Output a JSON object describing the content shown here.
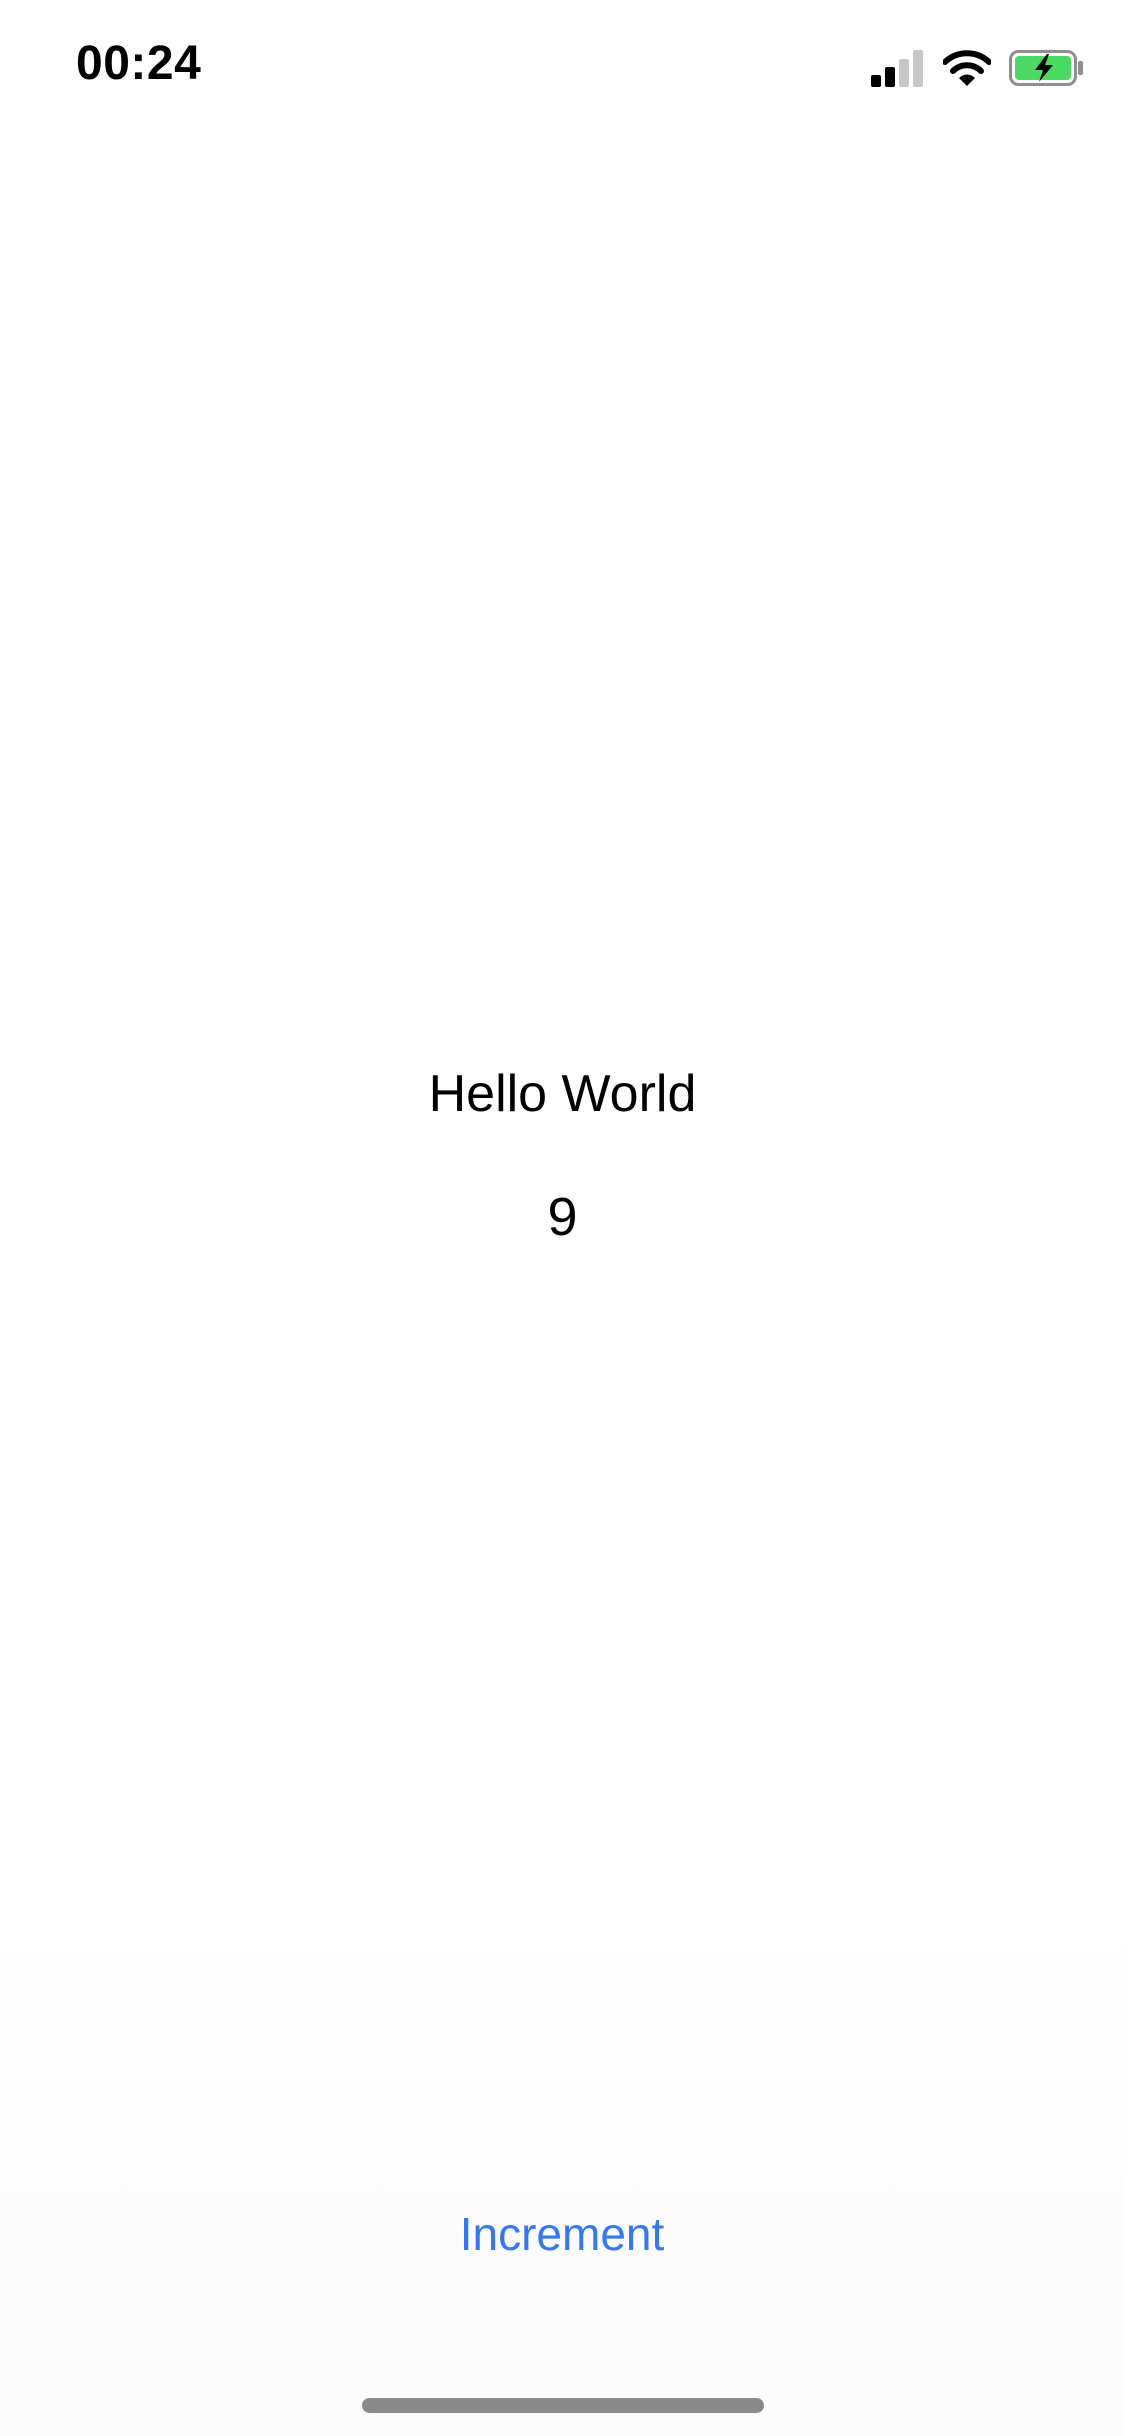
{
  "status_bar": {
    "time": "00:24",
    "icons": [
      "cellular-signal-icon",
      "wifi-icon",
      "battery-charging-icon"
    ],
    "battery_color": "#4cd964"
  },
  "content": {
    "title": "Hello World",
    "counter": "9"
  },
  "actions": {
    "increment_label": "Increment",
    "accent_color": "#3478f6"
  }
}
